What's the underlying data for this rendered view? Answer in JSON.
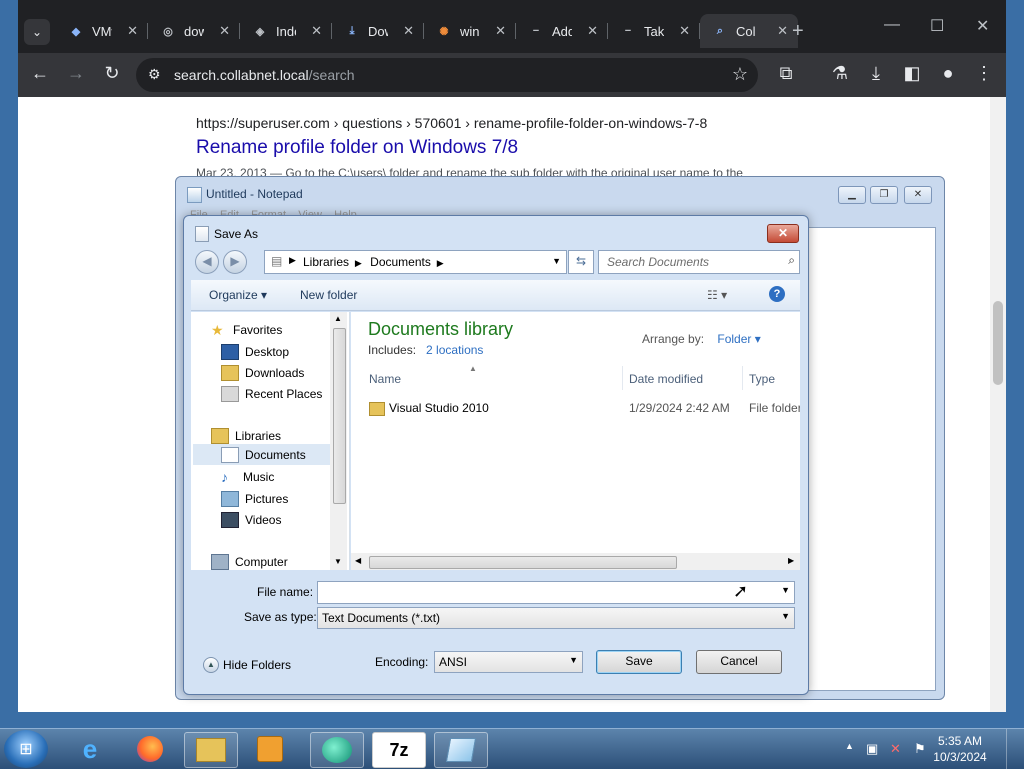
{
  "browser": {
    "tabs": [
      {
        "title": "VMware",
        "icon": "vmware-icon",
        "color": "#8ab4f8"
      },
      {
        "title": "download",
        "icon": "globe-icon",
        "color": "#bdc1c6"
      },
      {
        "title": "Index",
        "icon": "box-icon",
        "color": "#bdc1c6"
      },
      {
        "title": "Download",
        "icon": "download-icon",
        "color": "#8ab4f8"
      },
      {
        "title": "windows",
        "icon": "gear-icon",
        "color": "#f08c3a"
      },
      {
        "title": "Add",
        "icon": "minus-icon",
        "color": "#bdc1c6"
      },
      {
        "title": "Take",
        "icon": "minus-icon",
        "color": "#bdc1c6"
      },
      {
        "title": "Collabnet",
        "icon": "search-icon",
        "color": "#8ab4f8",
        "active": true
      }
    ],
    "url_host": "search.collabnet.local",
    "url_path": "/search"
  },
  "result": {
    "cite": "https://superuser.com  › questions › 570601 › rename-profile-folder-on-windows-7-8",
    "title": "Rename profile folder on Windows 7/8",
    "snippet": "Mar 23, 2013 — Go to the C:\\users\\ folder and rename the sub folder with the original user name to the"
  },
  "notepad": {
    "title": "Untitled - Notepad",
    "menu": [
      "File",
      "Edit",
      "Format",
      "View",
      "Help"
    ]
  },
  "saveas": {
    "title": "Save As",
    "breadcrumb": [
      "Libraries",
      "Documents"
    ],
    "search_placeholder": "Search Documents",
    "organize_label": "Organize",
    "new_folder_label": "New folder",
    "nav": {
      "favorites": "Favorites",
      "desktop": "Desktop",
      "downloads": "Downloads",
      "recent": "Recent Places",
      "libraries": "Libraries",
      "documents": "Documents",
      "music": "Music",
      "pictures": "Pictures",
      "videos": "Videos",
      "computer": "Computer"
    },
    "library_title": "Documents library",
    "includes_label": "Includes:",
    "includes_link": "2 locations",
    "arrange_label": "Arrange by:",
    "arrange_value": "Folder",
    "columns": {
      "name": "Name",
      "date": "Date modified",
      "type": "Type"
    },
    "files": [
      {
        "name": "Visual Studio 2010",
        "date": "1/29/2024 2:42 AM",
        "type": "File folder"
      }
    ],
    "file_name_label": "File name:",
    "file_name_value": "",
    "save_type_label": "Save as type:",
    "save_type_value": "Text Documents (*.txt)",
    "hide_folders": "Hide Folders",
    "encoding_label": "Encoding:",
    "encoding_value": "ANSI",
    "save_label": "Save",
    "cancel_label": "Cancel"
  },
  "taskbar": {
    "time": "5:35 AM",
    "date": "10/3/2024",
    "sevenzip": "7z"
  }
}
